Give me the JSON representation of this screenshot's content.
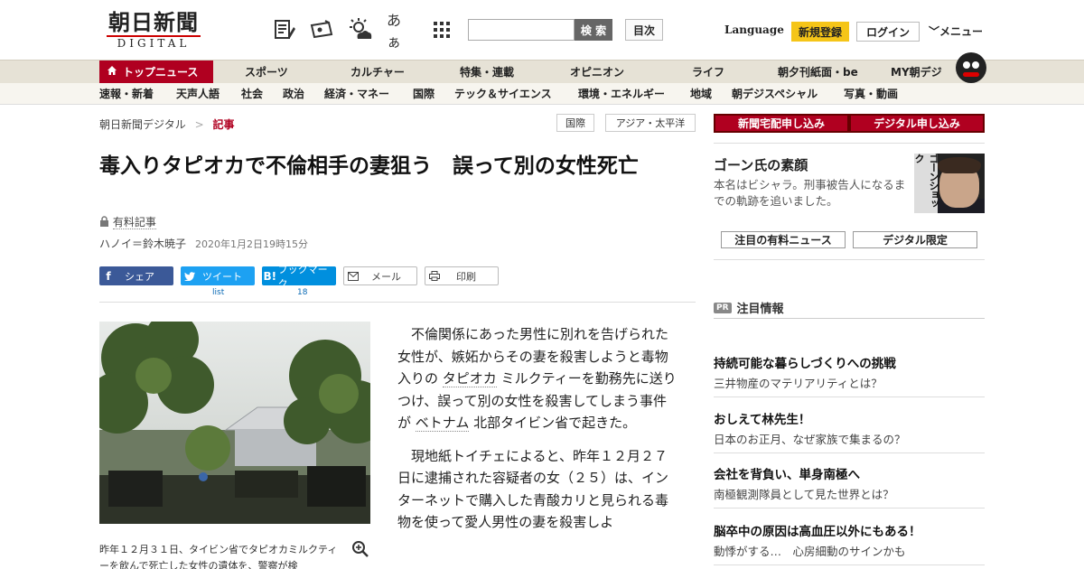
{
  "header": {
    "logo_main": "朝日新聞",
    "logo_sub": "DIGITAL",
    "search_button": "検 索",
    "index_button": "目次",
    "language": "Language",
    "register": "新規登録",
    "login": "ログイン",
    "menu": "メニュー",
    "icons": [
      "paper-edit-icon",
      "ticket-icon",
      "weather-icon",
      "font-size-icon",
      "grid-apps-icon"
    ],
    "font_icon_text": "あぁ"
  },
  "nav_primary": [
    {
      "label": "トップニュース",
      "active": true
    },
    {
      "label": "スポーツ"
    },
    {
      "label": "カルチャー"
    },
    {
      "label": "特集・連載"
    },
    {
      "label": "オピニオン"
    },
    {
      "label": "ライフ"
    },
    {
      "label": "朝夕刊紙面・be"
    },
    {
      "label": "MY朝デジ"
    }
  ],
  "nav_secondary": [
    "速報・新着",
    "天声人語",
    "社会",
    "政治",
    "経済・マネー",
    "国際",
    "テック＆サイエンス",
    "環境・エネルギー",
    "地域",
    "朝デジスペシャル",
    "写真・動画"
  ],
  "breadcrumb": {
    "home": "朝日新聞デジタル",
    "sep": ">",
    "current": "記事"
  },
  "tags": [
    "国際",
    "アジア・太平洋"
  ],
  "article": {
    "title": "毒入りタピオカで不倫相手の妻狙う　誤って別の女性死亡",
    "paid_label": "有料記事",
    "byline": "ハノイ＝鈴木暁子",
    "date": "2020年1月2日19時15分",
    "share": {
      "facebook": "シェア",
      "twitter": "ツイート",
      "hatena": "ブックマーク",
      "hatena_logo": "B!",
      "mail": "メール",
      "print": "印刷",
      "twitter_count": "list",
      "hatena_count": "18"
    },
    "caption": "昨年１２月３１日、タイビン省でタピオカミルクティーを飲んで死亡した女性の遺体を、警察が検",
    "para1_a": "不倫関係にあった男性に別れを告げられた女性が、嫉妬からその妻を殺害しようと毒物入りの",
    "para1_link1": "タピオカ",
    "para1_b": "ミルクティーを勤務先に送りつけ、誤って別の女性を殺害してしまう事件が",
    "para1_link2": "ベトナム",
    "para1_c": "北部タイビン省で起きた。",
    "para2": "現地紙トイチェによると、昨年１２月２７日に逮捕された容疑者の女（２５）は、インターネットで購入した青酸カリと見られる毒物を使って愛人男性の妻を殺害しよ"
  },
  "sidebar": {
    "subscribe_paper": "新聞宅配申し込み",
    "subscribe_digital": "デジタル申し込み",
    "feature_title": "ゴーン氏の素顔",
    "feature_desc": "本名はビシャラ。刑事被告人になるまでの軌跡を追いました。",
    "feature_image_text": "ゴーンショック",
    "pill1": "注目の有料ニュース",
    "pill2": "デジタル限定",
    "pr_badge": "PR",
    "pr_title": "注目情報",
    "pr_items": [
      {
        "head": "持続可能な暮らしづくりへの挑戦",
        "sub": "三井物産のマテリアリティとは？"
      },
      {
        "head": "おしえて林先生！",
        "sub": "日本のお正月、なぜ家族で集まるの？"
      },
      {
        "head": "会社を背負い、単身南極へ",
        "sub": "南極観測隊員として見た世界とは？"
      },
      {
        "head": "脳卒中の原因は高血圧以外にもある！",
        "sub": "動悸がする…　心房細動のサインかも"
      }
    ]
  },
  "colors": {
    "brand_red": "#b00020",
    "nav_bg": "#e6e2d6",
    "register_yellow": "#f5c518"
  }
}
